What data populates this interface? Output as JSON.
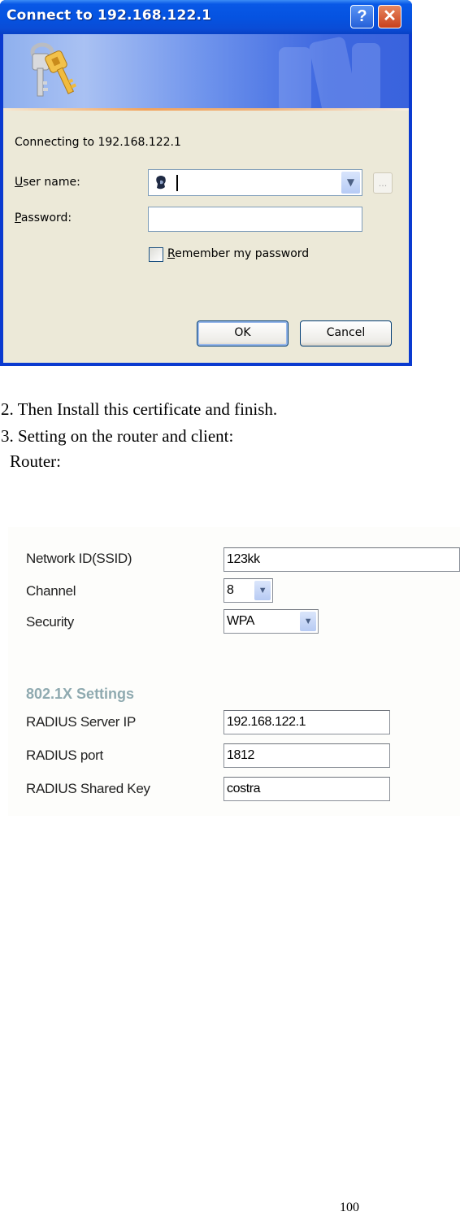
{
  "dialog": {
    "title": "Connect to 192.168.122.1",
    "help_button": "?",
    "close_button": "✕",
    "connecting_text": "Connecting to 192.168.122.1",
    "username_label_accel": "U",
    "username_label_rest": "ser name:",
    "username_value": "",
    "browse_button": "...",
    "password_label_accel": "P",
    "password_label_rest": "assword:",
    "password_value": "",
    "remember_label_accel": "R",
    "remember_label_rest": "emember my password",
    "remember_checked": false,
    "ok_button": "OK",
    "cancel_button": "Cancel"
  },
  "document": {
    "step2": "2. Then Install this certificate and finish.",
    "step3": "3. Setting on the router and client:",
    "router_heading": "Router:",
    "page_number": "100"
  },
  "router": {
    "ssid_label": "Network ID(SSID)",
    "ssid_value": "123kk",
    "channel_label": "Channel",
    "channel_value": "8",
    "security_label": "Security",
    "security_value": "WPA",
    "section_title": "802.1X Settings",
    "radius_ip_label": "RADIUS Server IP",
    "radius_ip_value": "192.168.122.1",
    "radius_port_label": "RADIUS port",
    "radius_port_value": "1812",
    "radius_key_label": "RADIUS Shared Key",
    "radius_key_value": "costra"
  }
}
